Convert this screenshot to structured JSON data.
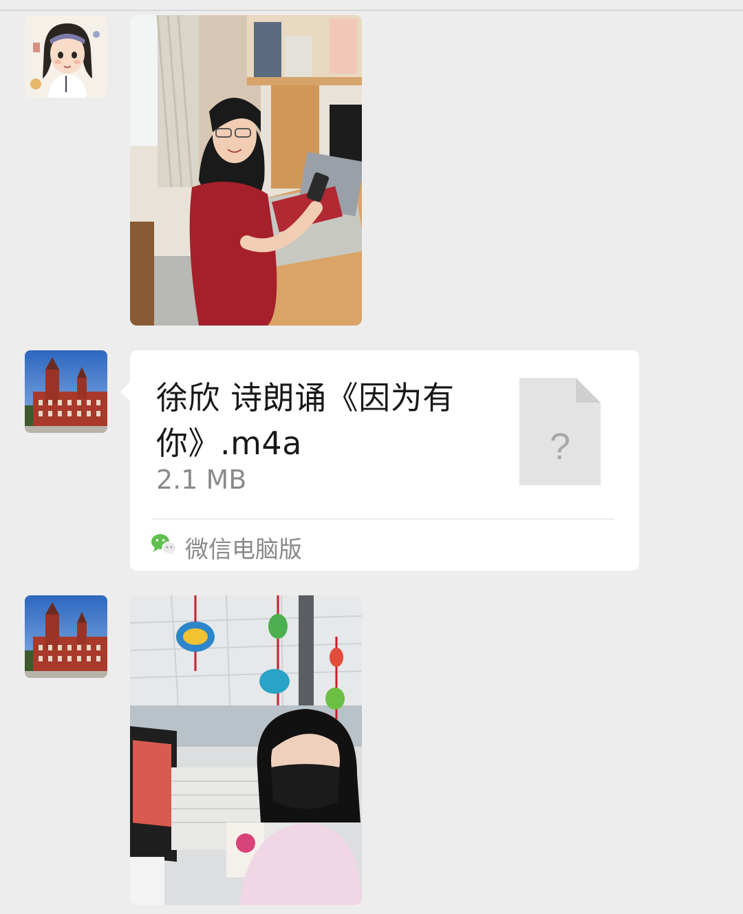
{
  "messages": [
    {
      "type": "image",
      "avatar": "cartoon-girl-avatar",
      "image": "woman-at-desk-photo"
    },
    {
      "type": "file",
      "avatar": "red-brick-building-avatar",
      "file_name": "徐欣 诗朗诵《因为有你》.m4a",
      "file_size": "2.1 MB",
      "file_icon": "unknown-file-icon",
      "file_icon_glyph": "?",
      "source_icon": "wechat-icon",
      "source_label": "微信电脑版"
    },
    {
      "type": "image",
      "avatar": "red-brick-building-avatar",
      "image": "woman-with-mask-office-photo"
    }
  ],
  "colors": {
    "background": "#ededed",
    "bubble": "#ffffff",
    "secondary_text": "#8a8a8a",
    "primary_text": "#181818",
    "wechat_green": "#5fbf4f"
  }
}
